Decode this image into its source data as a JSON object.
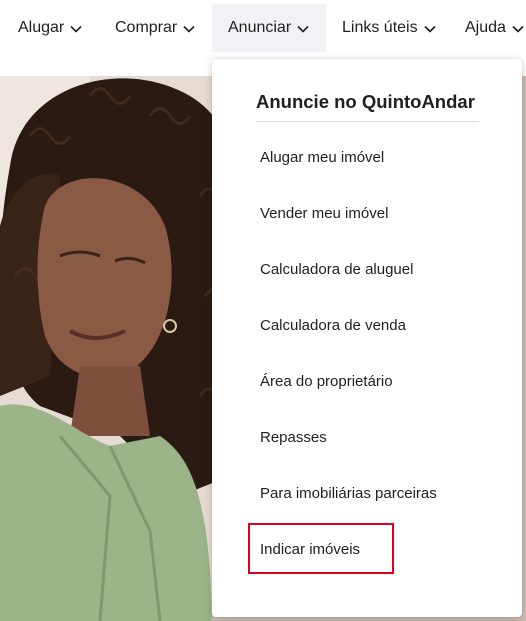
{
  "nav": {
    "items": [
      {
        "label": "Alugar"
      },
      {
        "label": "Comprar"
      },
      {
        "label": "Anunciar"
      },
      {
        "label": "Links úteis"
      },
      {
        "label": "Ajuda"
      }
    ]
  },
  "dropdown": {
    "title": "Anuncie no QuintoAndar",
    "items": [
      {
        "label": "Alugar meu imóvel"
      },
      {
        "label": "Vender meu imóvel"
      },
      {
        "label": "Calculadora de aluguel"
      },
      {
        "label": "Calculadora de venda"
      },
      {
        "label": "Área do proprietário"
      },
      {
        "label": "Repasses"
      },
      {
        "label": "Para imobiliárias parceiras"
      },
      {
        "label": "Indicar imóveis"
      }
    ],
    "highlighted_index": 7
  },
  "colors": {
    "highlight": "#e2001a",
    "nav_active_bg": "#f1f2f5",
    "text": "#1f1f1f"
  }
}
